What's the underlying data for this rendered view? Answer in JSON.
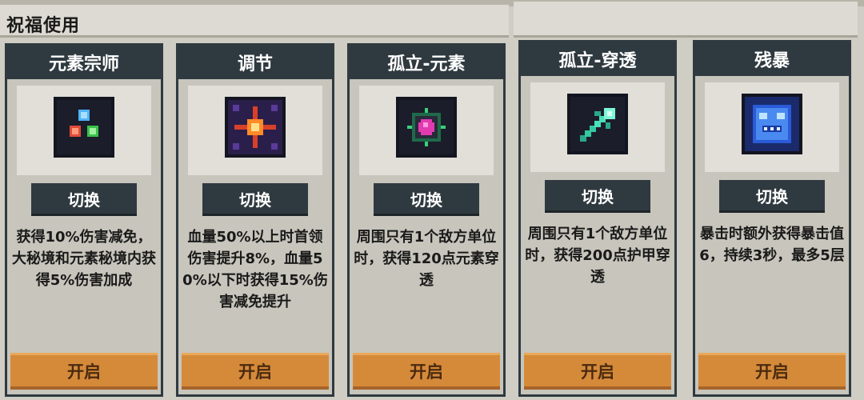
{
  "panel": {
    "title": "祝福使用"
  },
  "cards": [
    {
      "name": "元素宗师",
      "switch_label": "切换",
      "desc": "获得10%伤害减免，大秘境和元素秘境内获得5%伤害加成",
      "button": "开启",
      "icon": "elemental-orbs-icon"
    },
    {
      "name": "调节",
      "switch_label": "切换",
      "desc": "血量50%以上时首领伤害提升8%，血量50%以下时获得15%伤害减免提升",
      "button": "开启",
      "icon": "starburst-icon"
    },
    {
      "name": "孤立-元素",
      "switch_label": "切换",
      "desc": "周围只有1个敌方单位时，获得120点元素穿透",
      "button": "开启",
      "icon": "isolated-gem-icon"
    },
    {
      "name": "孤立-穿透",
      "switch_label": "切换",
      "desc": "周围只有1个敌方单位时，获得200点护甲穿透",
      "button": "开启",
      "icon": "piercing-arrow-icon"
    },
    {
      "name": "残暴",
      "switch_label": "切换",
      "desc": "暴击时额外获得暴击值6，持续3秒，最多5层",
      "button": "开启",
      "icon": "blue-beast-icon"
    }
  ],
  "colors": {
    "card_header": "#2f3a40",
    "button_orange": "#d58a3a",
    "background": "#cfcdc4"
  }
}
